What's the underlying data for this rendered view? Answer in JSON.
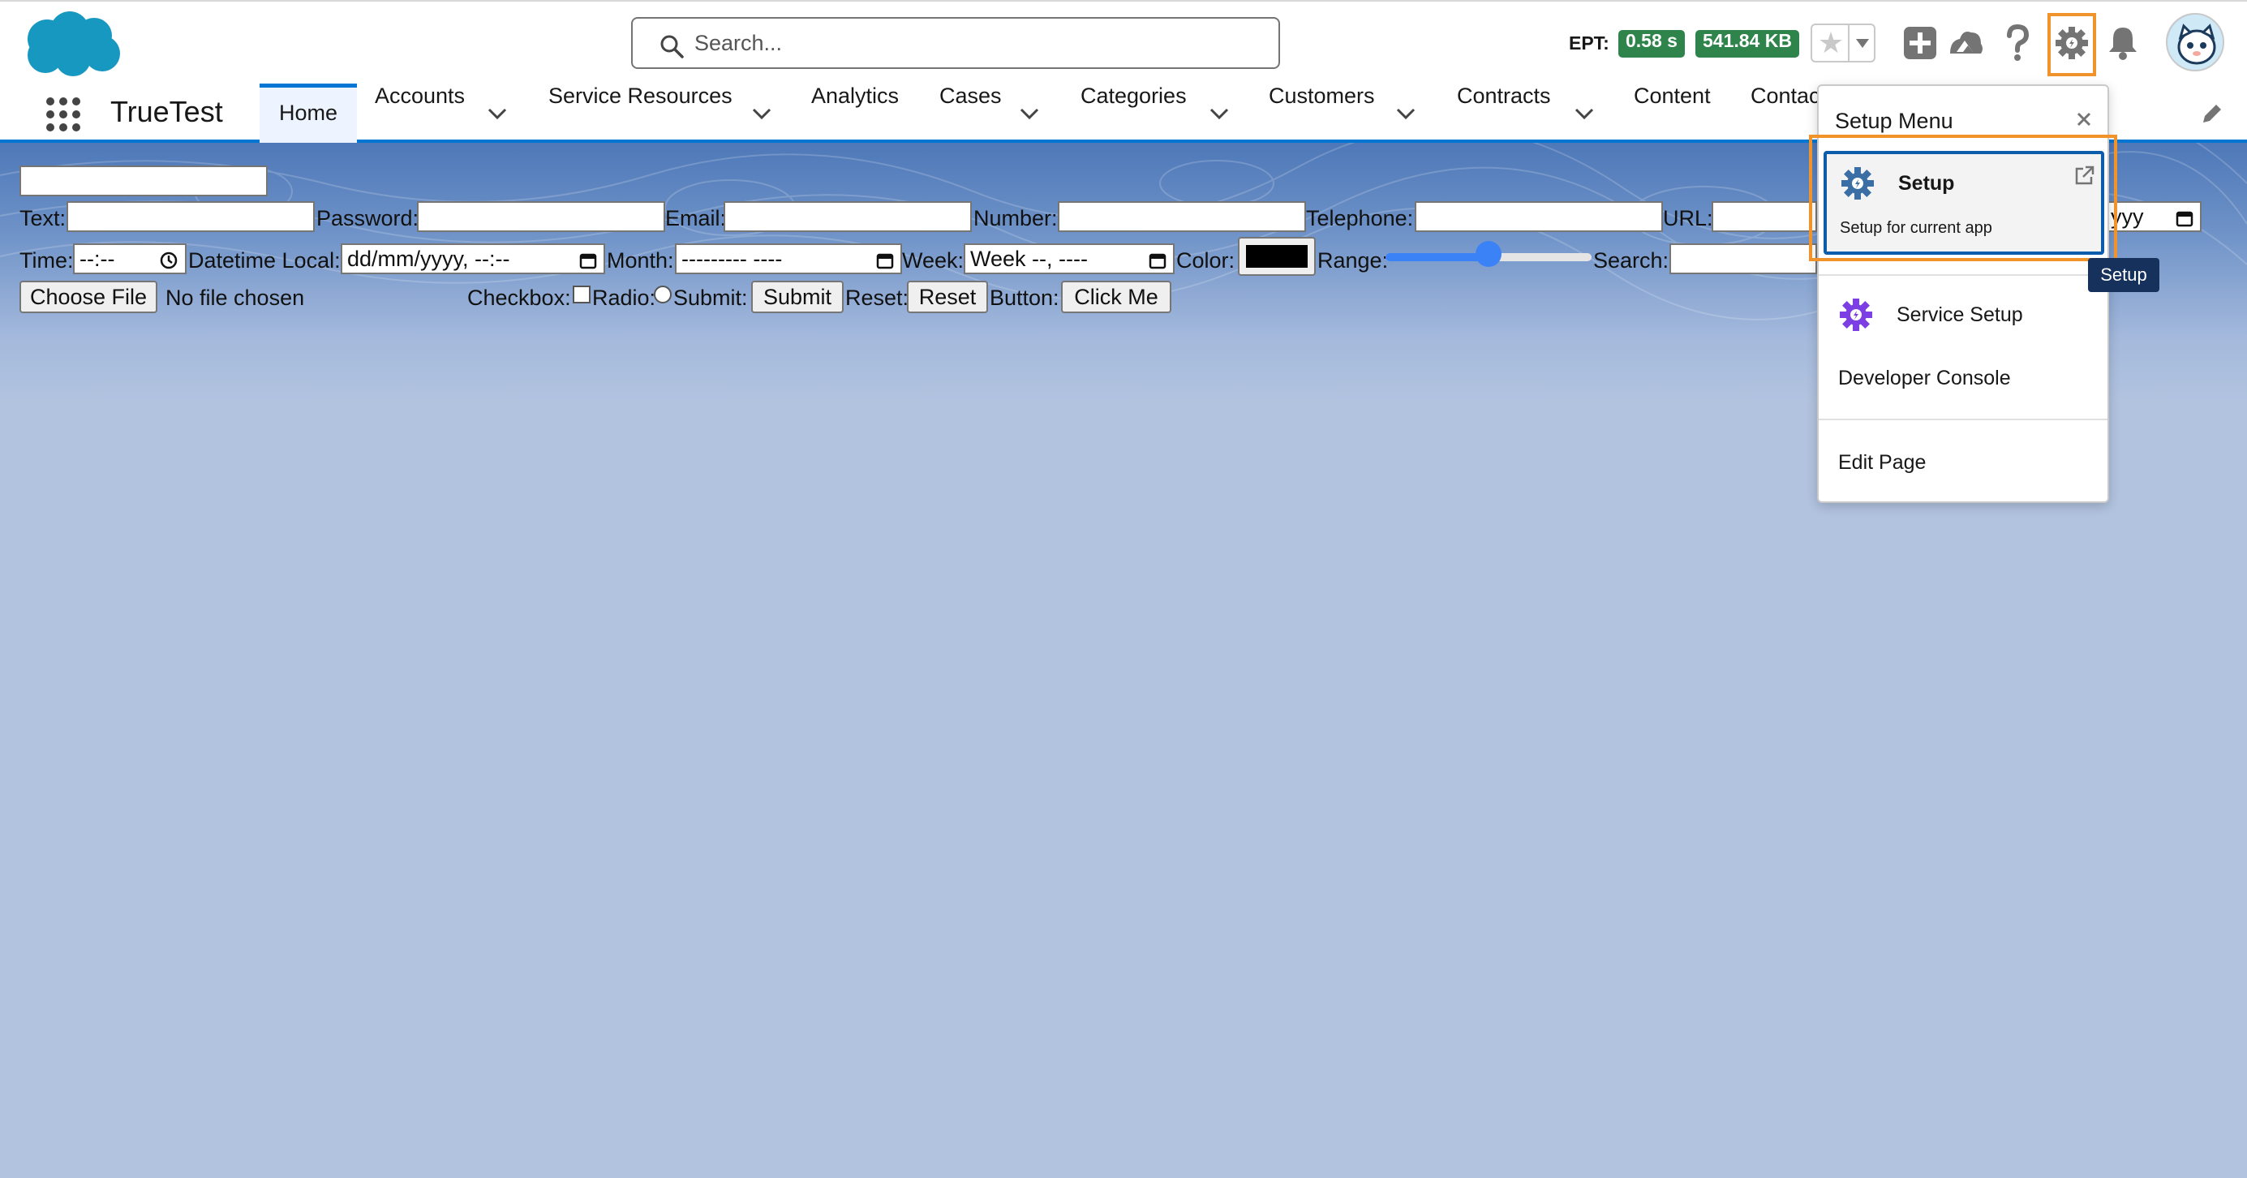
{
  "header": {
    "search_placeholder": "Search...",
    "ept_label": "EPT:",
    "ept_time": "0.58 s",
    "ept_size": "541.84 KB",
    "icons": [
      "favorites-star-icon",
      "add-icon",
      "trailhead-icon",
      "help-icon",
      "setup-gear-icon",
      "notifications-bell-icon",
      "avatar"
    ]
  },
  "nav": {
    "app_name": "TrueTest",
    "items": [
      {
        "label": "Home",
        "active": true,
        "has_menu": false
      },
      {
        "label": "Accounts",
        "active": false,
        "has_menu": true
      },
      {
        "label": "Service Resources",
        "active": false,
        "has_menu": true
      },
      {
        "label": "Analytics",
        "active": false,
        "has_menu": false
      },
      {
        "label": "Cases",
        "active": false,
        "has_menu": true
      },
      {
        "label": "Categories",
        "active": false,
        "has_menu": true
      },
      {
        "label": "Customers",
        "active": false,
        "has_menu": true
      },
      {
        "label": "Contracts",
        "active": false,
        "has_menu": true
      },
      {
        "label": "Content",
        "active": false,
        "has_menu": false
      },
      {
        "label": "Contac",
        "active": false,
        "has_menu": false
      }
    ]
  },
  "form": {
    "text_label": "Text:",
    "password_label": "Password:",
    "email_label": "Email:",
    "number_label": "Number:",
    "telephone_label": "Telephone:",
    "url_label": "URL:",
    "date_value_visible": "yyy",
    "time_label": "Time:",
    "time_value": "--:--",
    "datetime_label": "Datetime Local:",
    "datetime_value": "dd/mm/yyyy, --:--",
    "month_label": "Month:",
    "month_value": "--------- ----",
    "week_label": "Week:",
    "week_value": "Week --, ----",
    "color_label": "Color:",
    "color_value": "#000000",
    "range_label": "Range:",
    "range_value_percent": 50,
    "search_label": "Search:",
    "choose_file_label": "Choose File",
    "no_file_label": "No file chosen",
    "checkbox_label": "Checkbox:",
    "radio_label": "Radio:",
    "submit_label": "Submit:",
    "submit_button": "Submit",
    "reset_label": "Reset:",
    "reset_button": "Reset",
    "button_label": "Button:",
    "button_button": "Click Me"
  },
  "setup_menu": {
    "title": "Setup Menu",
    "setup_title": "Setup",
    "setup_subtitle": "Setup for current app",
    "service_setup": "Service Setup",
    "developer_console": "Developer Console",
    "edit_page": "Edit Page",
    "tooltip": "Setup"
  },
  "colors": {
    "brand_blue": "#0176d3",
    "highlight_orange": "#f0932b",
    "ept_green": "#2e844a",
    "setup_card_border": "#0b5cab",
    "service_setup_purple": "#7b3fe4"
  }
}
